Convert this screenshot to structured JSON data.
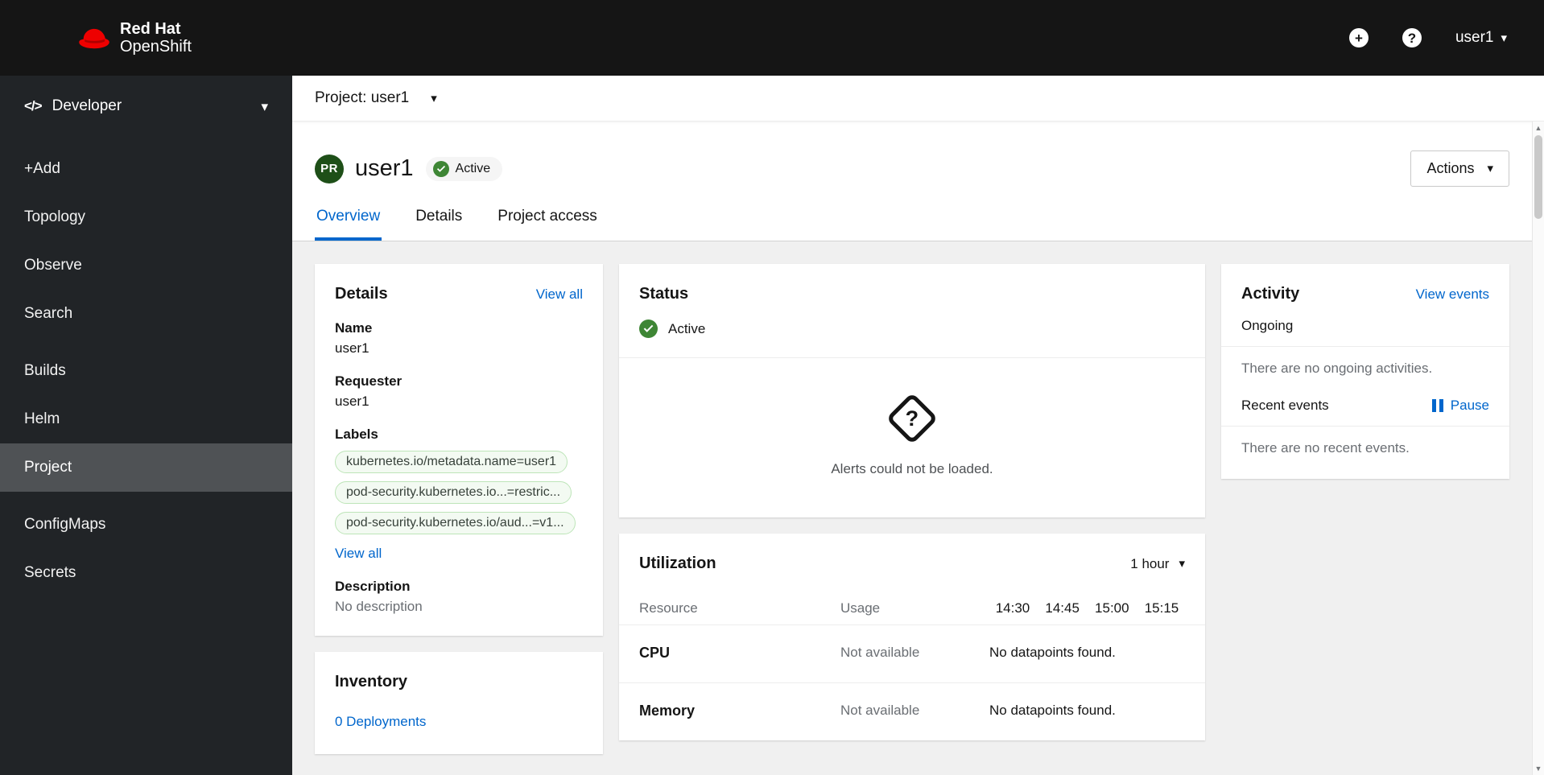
{
  "colors": {
    "accent": "#0066cc",
    "masthead-bg": "#151515",
    "sidebar-bg": "#212427",
    "success": "#3e8635",
    "content-bg": "#f0f0f0"
  },
  "icons": {
    "caret_down": "▾",
    "plus": "+",
    "help": "?",
    "question": "?",
    "code": "</>",
    "scroll_up": "▲",
    "scroll_down": "▼"
  },
  "masthead": {
    "brand_line1": "Red Hat",
    "brand_line2": "OpenShift",
    "username": "user1"
  },
  "sidebar": {
    "perspective": "Developer",
    "items": [
      "+Add",
      "Topology",
      "Observe",
      "Search",
      "Builds",
      "Helm",
      "Project",
      "ConfigMaps",
      "Secrets"
    ]
  },
  "project_bar": {
    "label": "Project: user1"
  },
  "page_header": {
    "badge": "PR",
    "title": "user1",
    "status": "Active",
    "actions": "Actions"
  },
  "tabs": [
    "Overview",
    "Details",
    "Project access"
  ],
  "details": {
    "title": "Details",
    "view_all": "View all",
    "name_label": "Name",
    "name": "user1",
    "requester_label": "Requester",
    "requester": "user1",
    "labels_label": "Labels",
    "labels": [
      "kubernetes.io/metadata.name=user1",
      "pod-security.kubernetes.io...=restric...",
      "pod-security.kubernetes.io/aud...=v1..."
    ],
    "view_all_labels": "View all",
    "description_label": "Description",
    "description": "No description"
  },
  "inventory": {
    "title": "Inventory",
    "deployments_link": "0 Deployments"
  },
  "status": {
    "title": "Status",
    "state": "Active",
    "alerts_message": "Alerts could not be loaded."
  },
  "utilization": {
    "title": "Utilization",
    "duration": "1 hour",
    "resource_col": "Resource",
    "usage_col": "Usage",
    "times": [
      "14:30",
      "14:45",
      "15:00",
      "15:15"
    ],
    "rows": [
      {
        "name": "CPU",
        "usage": "Not available",
        "datapoints": "No datapoints found."
      },
      {
        "name": "Memory",
        "usage": "Not available",
        "datapoints": "No datapoints found."
      }
    ]
  },
  "activity": {
    "title": "Activity",
    "view_events": "View events",
    "ongoing_label": "Ongoing",
    "ongoing_empty": "There are no ongoing activities.",
    "recent_label": "Recent events",
    "pause": "Pause",
    "recent_empty": "There are no recent events."
  }
}
